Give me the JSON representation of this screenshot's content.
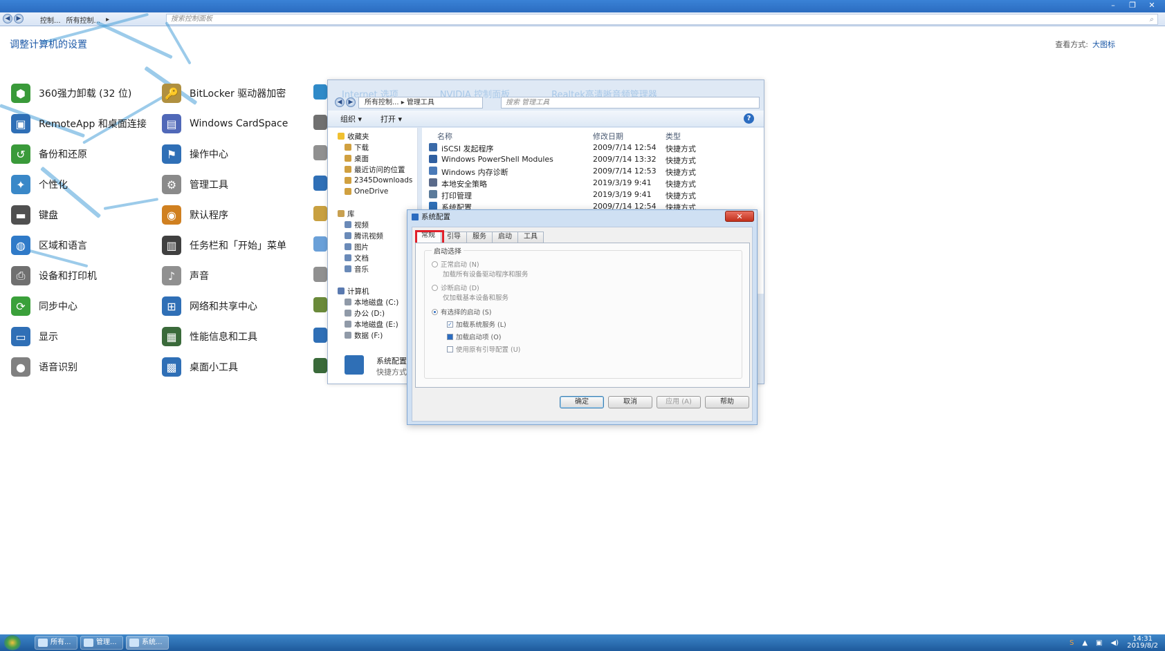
{
  "control_panel": {
    "nav": {
      "back": "◀",
      "forward": "▶"
    },
    "breadcrumb": [
      "控制...",
      "所有控制...",
      "▸"
    ],
    "search_placeholder": "搜索控制面板",
    "heading": "调整计算机的设置",
    "view_by_label": "查看方式:",
    "view_by_value": "大图标",
    "window_controls": {
      "minimize": "–",
      "restore": "❐",
      "close": "✕"
    },
    "items": [
      {
        "label": "360强力卸载 (32 位)",
        "icon": "uninstall-icon",
        "color": "#3a9a3a"
      },
      {
        "label": "BitLocker 驱动器加密",
        "icon": "key-icon",
        "color": "#b09040"
      },
      {
        "label": "RemoteApp 和桌面连接",
        "icon": "remote-desktop-icon",
        "color": "#2f6fb6"
      },
      {
        "label": "Windows CardSpace",
        "icon": "cardspace-icon",
        "color": "#5068b8"
      },
      {
        "label": "备份和还原",
        "icon": "backup-icon",
        "color": "#3a9a3a"
      },
      {
        "label": "操作中心",
        "icon": "flag-icon",
        "color": "#2f6fb6"
      },
      {
        "label": "个性化",
        "icon": "personalize-icon",
        "color": "#3a88c8"
      },
      {
        "label": "管理工具",
        "icon": "admin-tools-icon",
        "color": "#8a8a8a"
      },
      {
        "label": "键盘",
        "icon": "keyboard-icon",
        "color": "#505050"
      },
      {
        "label": "默认程序",
        "icon": "default-programs-icon",
        "color": "#d08020"
      },
      {
        "label": "区域和语言",
        "icon": "globe-icon",
        "color": "#2f7ac8"
      },
      {
        "label": "任务栏和「开始」菜单",
        "icon": "taskbar-icon",
        "color": "#404040"
      },
      {
        "label": "设备和打印机",
        "icon": "printer-icon",
        "color": "#707070"
      },
      {
        "label": "声音",
        "icon": "speaker-icon",
        "color": "#909090"
      },
      {
        "label": "同步中心",
        "icon": "sync-icon",
        "color": "#3aa03a"
      },
      {
        "label": "网络和共享中心",
        "icon": "network-icon",
        "color": "#2f6fb6"
      },
      {
        "label": "显示",
        "icon": "display-icon",
        "color": "#2f6fb6"
      },
      {
        "label": "性能信息和工具",
        "icon": "performance-icon",
        "color": "#3a6a3a"
      },
      {
        "label": "语音识别",
        "icon": "microphone-icon",
        "color": "#808080"
      },
      {
        "label": "桌面小工具",
        "icon": "gadgets-icon",
        "color": "#2f6fb6"
      }
    ]
  },
  "explorer": {
    "background_titles": [
      "Internet 选项",
      "NVIDIA 控制面板",
      "Realtek高清晰音频管理器"
    ],
    "breadcrumb": "所有控制... ▸ 管理工具",
    "search_placeholder": "搜索 管理工具",
    "toolbar": {
      "organize": "组织 ▾",
      "open": "打开 ▾",
      "help": "?"
    },
    "nav": {
      "favorites": "收藏夹",
      "favorites_items": [
        "下载",
        "桌面",
        "最近访问的位置",
        "2345Downloads",
        "OneDrive"
      ],
      "libraries": "库",
      "libraries_items": [
        "视频",
        "腾讯视频",
        "图片",
        "文档",
        "音乐"
      ],
      "computer": "计算机",
      "computer_items": [
        "本地磁盘 (C:)",
        "办公 (D:)",
        "本地磁盘 (E:)",
        "数据 (F:)"
      ]
    },
    "columns": {
      "name": "名称",
      "date": "修改日期",
      "type": "类型"
    },
    "files": [
      {
        "name": "iSCSI 发起程序",
        "date": "2009/7/14 12:54",
        "type": "快捷方式"
      },
      {
        "name": "Windows PowerShell Modules",
        "date": "2009/7/14 13:32",
        "type": "快捷方式"
      },
      {
        "name": "Windows 内存诊断",
        "date": "2009/7/14 12:53",
        "type": "快捷方式"
      },
      {
        "name": "本地安全策略",
        "date": "2019/3/19 9:41",
        "type": "快捷方式"
      },
      {
        "name": "打印管理",
        "date": "2019/3/19 9:41",
        "type": "快捷方式"
      },
      {
        "name": "系统配置",
        "date": "2009/7/14 12:54",
        "type": "快捷方式"
      }
    ],
    "details": {
      "name": "系统配置",
      "type": "快捷方式"
    }
  },
  "dialog": {
    "title": "系统配置",
    "close": "✕",
    "tabs": [
      "常规",
      "引导",
      "服务",
      "启动",
      "工具"
    ],
    "active_tab": "常规",
    "group_title": "启动选择",
    "options": {
      "normal": {
        "label": "正常启动 (N)",
        "desc": "加载所有设备驱动程序和服务",
        "selected": false
      },
      "diagnostic": {
        "label": "诊断启动 (D)",
        "desc": "仅加载基本设备和服务",
        "selected": false
      },
      "selective": {
        "label": "有选择的启动 (S)",
        "selected": true
      }
    },
    "checkboxes": [
      {
        "label": "加载系统服务 (L)",
        "state": "checked"
      },
      {
        "label": "加载启动项 (O)",
        "state": "indeterminate"
      },
      {
        "label": "使用原有引导配置 (U)",
        "state": "unchecked"
      }
    ],
    "buttons": {
      "ok": "确定",
      "cancel": "取消",
      "apply": "应用 (A)",
      "help": "帮助"
    },
    "highlight_color": "#e0202a"
  },
  "taskbar": {
    "tasks": [
      "所有...",
      "管理...",
      "系统..."
    ],
    "clock_time": "14:31",
    "clock_date": "2019/8/2"
  }
}
